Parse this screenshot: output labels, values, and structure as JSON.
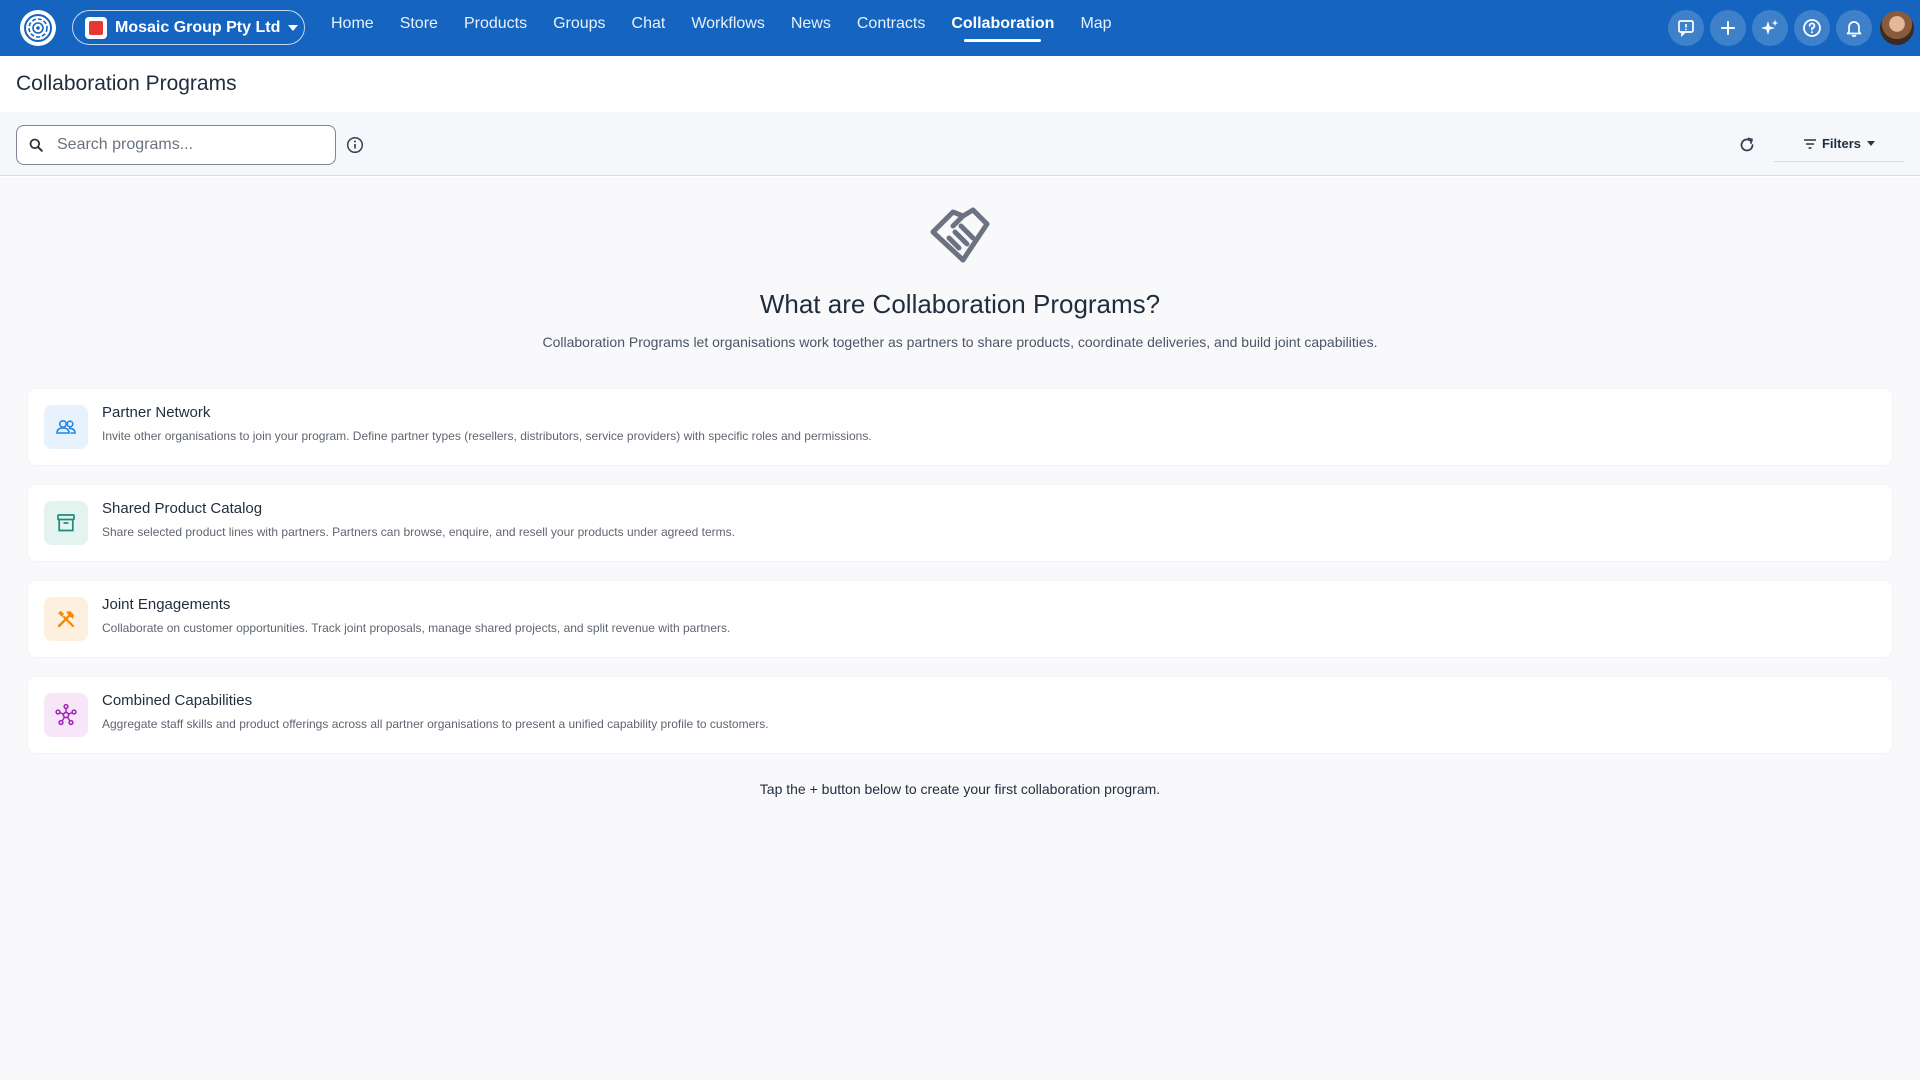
{
  "org": {
    "name": "Mosaic Group Pty Ltd"
  },
  "nav": [
    {
      "label": "Home",
      "active": false
    },
    {
      "label": "Store",
      "active": false
    },
    {
      "label": "Products",
      "active": false
    },
    {
      "label": "Groups",
      "active": false
    },
    {
      "label": "Chat",
      "active": false
    },
    {
      "label": "Workflows",
      "active": false
    },
    {
      "label": "News",
      "active": false
    },
    {
      "label": "Contracts",
      "active": false
    },
    {
      "label": "Collaboration",
      "active": true
    },
    {
      "label": "Map",
      "active": false
    }
  ],
  "top_actions": [
    "feedback-icon",
    "plus-icon",
    "sparkle-icon",
    "help-icon",
    "bell-icon"
  ],
  "page": {
    "title": "Collaboration Programs"
  },
  "search": {
    "placeholder": "Search programs..."
  },
  "toolbar": {
    "filters_label": "Filters"
  },
  "hero": {
    "icon": "handshake-icon",
    "title": "What are Collaboration Programs?",
    "description": "Collaboration Programs let organisations work together as partners to share products, coordinate deliveries, and build joint capabilities."
  },
  "features": [
    {
      "title": "Partner Network",
      "description": "Invite other organisations to join your program. Define partner types (resellers, distributors, service providers) with specific roles and permissions.",
      "icon": "people-icon",
      "color": "#1e88e5",
      "bg": "#e8f2fd"
    },
    {
      "title": "Shared Product Catalog",
      "description": "Share selected product lines with partners. Partners can browse, enquire, and resell your products under agreed terms.",
      "icon": "archive-box-icon",
      "color": "#1b8c7a",
      "bg": "#e3f3f0"
    },
    {
      "title": "Joint Engagements",
      "description": "Collaborate on customer opportunities. Track joint proposals, manage shared projects, and split revenue with partners.",
      "icon": "tools-icon",
      "color": "#f08c00",
      "bg": "#fdf0e1"
    },
    {
      "title": "Combined Capabilities",
      "description": "Aggregate staff skills and product offerings across all partner organisations to present a unified capability profile to customers.",
      "icon": "hub-icon",
      "color": "#a022b8",
      "bg": "#f6e6f8"
    }
  ],
  "cta": {
    "text": "Tap the + button below to create your first collaboration program."
  },
  "colors": {
    "topbar": "#1565c0",
    "background": "#f9f9fc"
  }
}
